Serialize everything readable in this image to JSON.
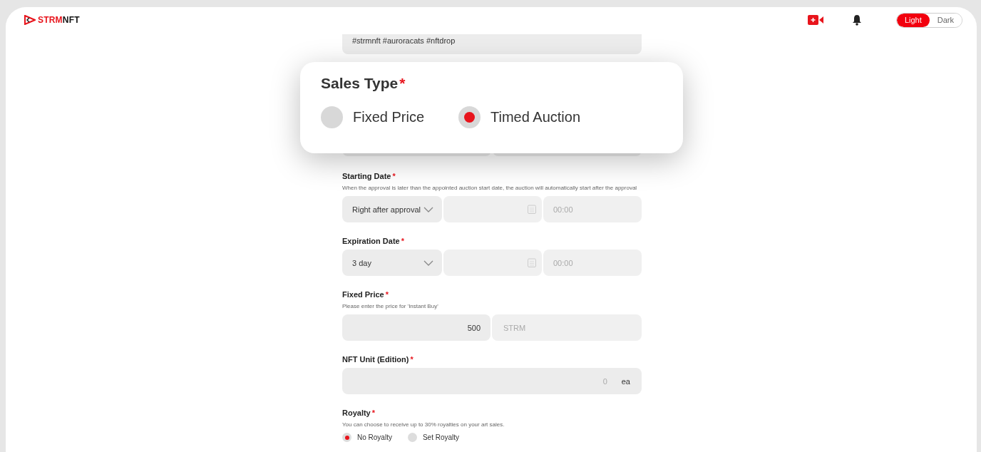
{
  "header": {
    "logo": {
      "part1": "STRM",
      "part2": "NFT"
    },
    "theme_toggle": [
      {
        "label": "Light",
        "selected": true
      },
      {
        "label": "Dark",
        "selected": false
      }
    ]
  },
  "tags_field": {
    "value": "#strmnft #auroracats #nftdrop"
  },
  "sales_type": {
    "title": "Sales Type",
    "required": "*",
    "options": [
      {
        "label": "Fixed Price",
        "selected": false
      },
      {
        "label": "Timed Auction",
        "selected": true
      }
    ]
  },
  "starting_date": {
    "label": "Starting Date",
    "required": "*",
    "hint": "When the approval is later than the appointed auction start date, the auction will automatically start after the approval",
    "select": "Right after approval",
    "time_placeholder": "00:00"
  },
  "expiration_date": {
    "label": "Expiration Date",
    "required": "*",
    "select": "3 day",
    "time_placeholder": "00:00"
  },
  "fixed_price": {
    "label": "Fixed Price",
    "required": "*",
    "hint": "Please enter the price for 'Instant Buy'",
    "value": "500",
    "currency": "STRM"
  },
  "nft_unit": {
    "label": "NFT Unit (Edition)",
    "required": "*",
    "placeholder": "0",
    "unit": "ea"
  },
  "royalty": {
    "label": "Royalty",
    "required": "*",
    "hint": "You can choose to receive up to 30% royalties on your art sales.",
    "options": [
      {
        "label": "No Royalty",
        "selected": true
      },
      {
        "label": "Set Royalty",
        "selected": false
      }
    ]
  }
}
